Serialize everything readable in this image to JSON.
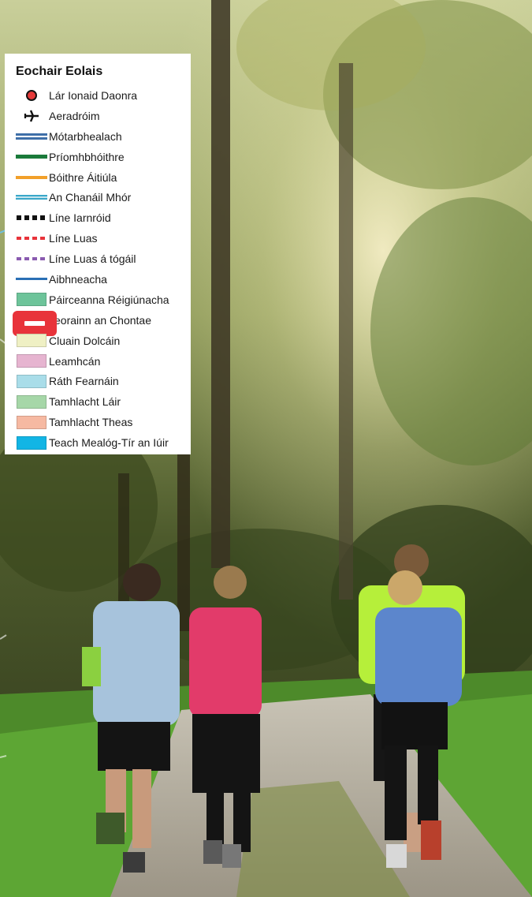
{
  "legend": {
    "title": "Eochair Eolais",
    "items": [
      {
        "label": "Lár Ionaid Daonra",
        "symbol": "population-centre-dot",
        "color": "#e53a3a"
      },
      {
        "label": "Aeradróim",
        "symbol": "airplane-icon",
        "color": "#111111"
      },
      {
        "label": "Mótarbhealach",
        "symbol": "motorway-line",
        "color": "#3f6fa8"
      },
      {
        "label": "Príomhbhóithre",
        "symbol": "primary-road-line",
        "color": "#1a7a3a"
      },
      {
        "label": "Bóithre Áitiúla",
        "symbol": "local-road-line",
        "color": "#f2a02a"
      },
      {
        "label": "An Chanáil Mhór",
        "symbol": "canal-line",
        "color": "#3aa7c9"
      },
      {
        "label": "Líne Iarnróid",
        "symbol": "railway-line",
        "color": "#111111"
      },
      {
        "label": "Líne Luas",
        "symbol": "luas-line",
        "color": "#e8333a"
      },
      {
        "label": "Líne Luas á tógáil",
        "symbol": "luas-construction-line",
        "color": "#8a5bb0"
      },
      {
        "label": "Aibhneacha",
        "symbol": "river-line",
        "color": "#2a6fb5"
      },
      {
        "label": "Páirceanna Réigiúnacha",
        "symbol": "regional-parks-swatch",
        "color": "#6dc49a"
      },
      {
        "label": "Teorainn an Chontae",
        "symbol": "county-boundary-marker",
        "color": "#e8333a"
      },
      {
        "label": "Cluain Dolcáin",
        "symbol": "area-swatch",
        "color": "#eff0c4"
      },
      {
        "label": "Leamhcán",
        "symbol": "area-swatch",
        "color": "#e6b4d0"
      },
      {
        "label": "Ráth Fearnáin",
        "symbol": "area-swatch",
        "color": "#a9dde9"
      },
      {
        "label": "Tamhlacht Láir",
        "symbol": "area-swatch",
        "color": "#a6d7a8"
      },
      {
        "label": "Tamhlacht Theas",
        "symbol": "area-swatch",
        "color": "#f6b9a2"
      },
      {
        "label": "Teach Mealóg-Tír an Iúir",
        "symbol": "area-swatch",
        "color": "#12b5e5"
      }
    ]
  }
}
